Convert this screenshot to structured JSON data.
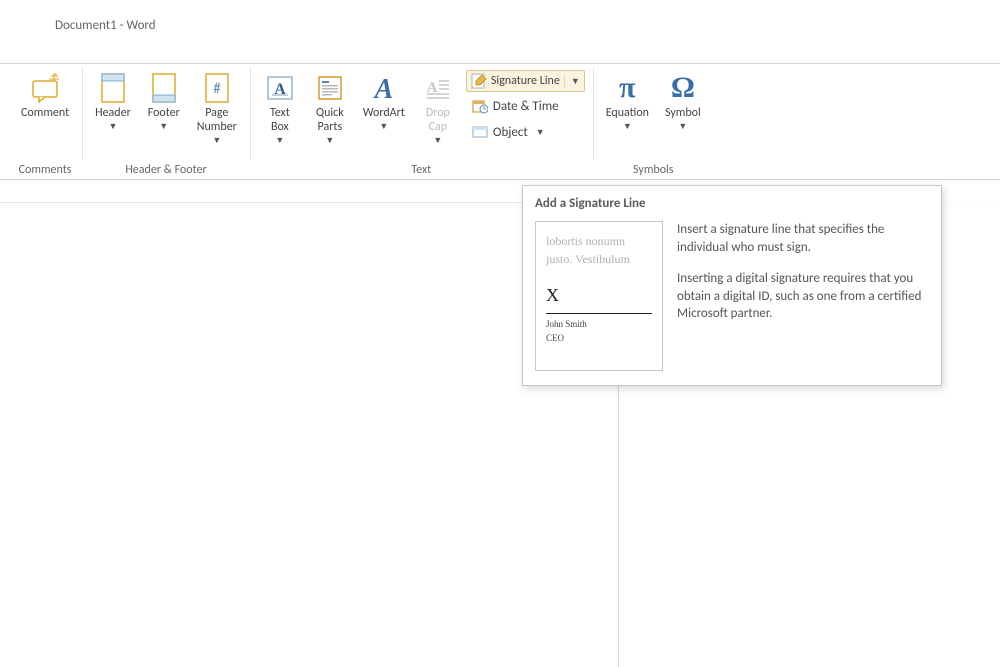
{
  "title": "Document1 - Word",
  "groups": {
    "comments": {
      "label": "Comments",
      "comment": "Comment"
    },
    "header_footer": {
      "label": "Header & Footer",
      "header": "Header",
      "footer": "Footer",
      "page_number": "Page\nNumber"
    },
    "text": {
      "label": "Text",
      "text_box": "Text\nBox",
      "quick_parts": "Quick\nParts",
      "wordart": "WordArt",
      "drop_cap": "Drop\nCap",
      "signature_line": "Signature Line",
      "date_time": "Date & Time",
      "object": "Object"
    },
    "symbols": {
      "label": "Symbols",
      "equation": "Equation",
      "symbol": "Symbol"
    }
  },
  "tooltip": {
    "title": "Add a Signature Line",
    "p1": "Insert a signature line that specifies the individual who must sign.",
    "p2": "Inserting a digital signature requires that you obtain a digital ID, such as one from a certified Microsoft partner.",
    "preview": {
      "lorem1": "lobortis nonumn",
      "lorem2": "justo. Vestibulum",
      "x": "X",
      "name": "John Smith",
      "role": "CEO"
    }
  }
}
